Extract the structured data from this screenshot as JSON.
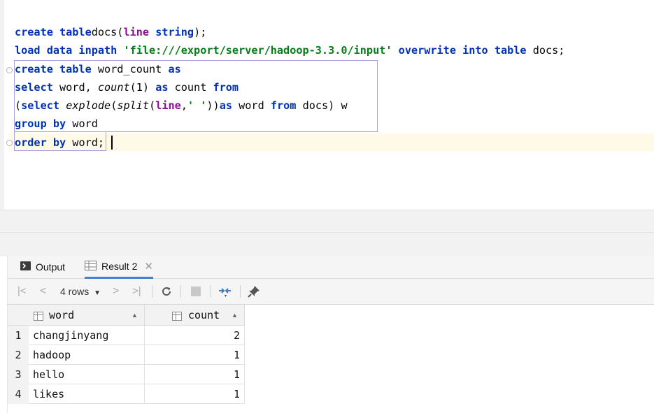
{
  "editor": {
    "lines": [
      {
        "parts": [
          [
            "kw",
            "create table"
          ],
          [
            "",
            "docs("
          ],
          [
            "param",
            "line"
          ],
          [
            "",
            " "
          ],
          [
            "kw",
            "string"
          ],
          [
            "",
            ");"
          ]
        ]
      },
      {
        "parts": [
          [
            "kw",
            "load data inpath"
          ],
          [
            "",
            " "
          ],
          [
            "str",
            "'file:///export/server/hadoop-3.3.0/input'"
          ],
          [
            "",
            " "
          ],
          [
            "kw",
            "overwrite into table"
          ],
          [
            "",
            " docs;"
          ]
        ]
      },
      {
        "parts": [
          [
            "kw",
            "create table"
          ],
          [
            "",
            " word_count "
          ],
          [
            "kw",
            "as"
          ]
        ]
      },
      {
        "parts": [
          [
            "kw",
            "select"
          ],
          [
            "",
            " word, "
          ],
          [
            "ital",
            "count"
          ],
          [
            "",
            "(1) "
          ],
          [
            "kw",
            "as"
          ],
          [
            "",
            " count "
          ],
          [
            "kw",
            "from"
          ]
        ]
      },
      {
        "parts": [
          [
            "",
            "("
          ],
          [
            "kw",
            "select"
          ],
          [
            "",
            " "
          ],
          [
            "ital",
            "explode"
          ],
          [
            "",
            "("
          ],
          [
            "ital",
            "split"
          ],
          [
            "",
            "("
          ],
          [
            "param",
            "line"
          ],
          [
            "",
            ","
          ],
          [
            "str",
            "' '"
          ],
          [
            "",
            "))"
          ],
          [
            "kw",
            "as"
          ],
          [
            "",
            " word "
          ],
          [
            "kw",
            "from"
          ],
          [
            "",
            " docs) w"
          ]
        ]
      },
      {
        "parts": [
          [
            "kw",
            "group by"
          ],
          [
            "",
            " word"
          ]
        ]
      },
      {
        "parts": [
          [
            "kw",
            "order by"
          ],
          [
            "",
            " word;"
          ]
        ]
      }
    ]
  },
  "tabs": {
    "output_label": "Output",
    "result_label": "Result 2"
  },
  "toolbar": {
    "rows_label": "4 rows"
  },
  "grid": {
    "columns": [
      "word",
      "count"
    ],
    "rows": [
      {
        "n": "1",
        "word": "changjinyang",
        "count": "2"
      },
      {
        "n": "2",
        "word": "hadoop",
        "count": "1"
      },
      {
        "n": "3",
        "word": "hello",
        "count": "1"
      },
      {
        "n": "4",
        "word": "likes",
        "count": "1"
      }
    ]
  },
  "icons": {
    "output": "terminal-icon",
    "result": "table-icon",
    "first": "first-page-icon",
    "prev": "previous-page-icon",
    "next": "next-page-icon",
    "last": "last-page-icon",
    "refresh": "refresh-icon",
    "stop": "stop-icon",
    "compare": "compare-icon",
    "pin": "pin-icon"
  }
}
